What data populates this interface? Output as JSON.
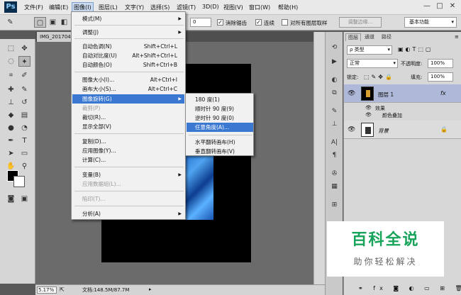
{
  "app": {
    "logo": "Ps"
  },
  "menubar": {
    "items": [
      "文件(F)",
      "编辑(E)",
      "图像(I)",
      "图层(L)",
      "文字(Y)",
      "选择(S)",
      "滤镜(T)",
      "3D(D)",
      "视图(V)",
      "窗口(W)",
      "帮助(H)"
    ],
    "active_index": 2,
    "window_controls": [
      "—",
      "□",
      "✕"
    ]
  },
  "options_bar": {
    "value_box": "0",
    "antialias_label": "消除锯齿",
    "contiguous_label": "连续",
    "all_layers_label": "对所有图层取样",
    "refine_edge_button": "调整边缘...",
    "workspace_select": "基本功能"
  },
  "document": {
    "tab_title": "IMG_201704",
    "zoom": "5.17%",
    "doc_info": "文档:148.5M/87.7M"
  },
  "image_menu": {
    "items": [
      {
        "label": "模式(M)",
        "arrow": true
      },
      {
        "label": "调整(J)",
        "arrow": true
      },
      {
        "label": "自动色调(N)",
        "shortcut": "Shift+Ctrl+L"
      },
      {
        "label": "自动对比度(U)",
        "shortcut": "Alt+Shift+Ctrl+L"
      },
      {
        "label": "自动颜色(O)",
        "shortcut": "Shift+Ctrl+B"
      },
      {
        "label": "图像大小(I)...",
        "shortcut": "Alt+Ctrl+I"
      },
      {
        "label": "画布大小(S)...",
        "shortcut": "Alt+Ctrl+C"
      },
      {
        "label": "图像旋转(G)",
        "arrow": true,
        "highlighted": true
      },
      {
        "label": "裁剪(P)",
        "disabled": true
      },
      {
        "label": "裁切(R)..."
      },
      {
        "label": "显示全部(V)"
      },
      {
        "label": "复制(D)..."
      },
      {
        "label": "应用图像(Y)..."
      },
      {
        "label": "计算(C)..."
      },
      {
        "label": "变量(B)",
        "arrow": true
      },
      {
        "label": "应用数据组(L)...",
        "disabled": true
      },
      {
        "label": "陷印(T)...",
        "disabled": true
      },
      {
        "label": "分析(A)",
        "arrow": true
      }
    ]
  },
  "rotate_submenu": {
    "items": [
      {
        "label": "180 度(1)"
      },
      {
        "label": "顺时针 90 度(9)"
      },
      {
        "label": "逆时针 90 度(0)"
      },
      {
        "label": "任意角度(A)...",
        "highlighted": true
      },
      {
        "label": "水平翻转画布(H)"
      },
      {
        "label": "垂直翻转画布(V)"
      }
    ]
  },
  "layers_panel": {
    "tabs": [
      "图层",
      "通道",
      "路径"
    ],
    "kind_filter": "类型",
    "blend_mode": "正常",
    "opacity_label": "不透明度:",
    "opacity_value": "100%",
    "lock_label": "锁定:",
    "fill_label": "填充:",
    "fill_value": "100%",
    "layers": [
      {
        "name": "图层 1",
        "fx": "fx",
        "effects_label": "效果",
        "effect_item": "颜色叠加"
      },
      {
        "name": "背景"
      }
    ]
  },
  "watermark": {
    "title": "百科全说",
    "subtitle": "助你轻松解决"
  },
  "colors": {
    "menu_highlight": "#3a78d2",
    "layer_selected": "#aeb8d8",
    "watermark_green": "#18a35a"
  }
}
